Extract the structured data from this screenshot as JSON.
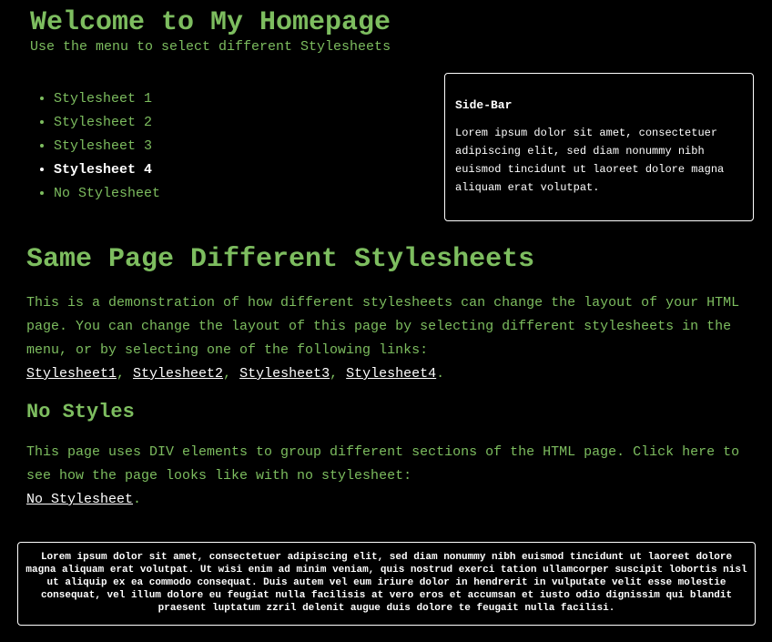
{
  "header": {
    "title": "Welcome to My Homepage",
    "subtitle": "Use the menu to select different Stylesheets"
  },
  "menu": {
    "items": [
      {
        "label": "Stylesheet 1",
        "active": false
      },
      {
        "label": "Stylesheet 2",
        "active": false
      },
      {
        "label": "Stylesheet 3",
        "active": false
      },
      {
        "label": "Stylesheet 4",
        "active": true
      },
      {
        "label": "No Stylesheet",
        "active": false
      }
    ]
  },
  "sidebar": {
    "title": "Side-Bar",
    "text": "Lorem ipsum dolor sit amet, consectetuer adipiscing elit, sed diam nonummy nibh euismod tincidunt ut laoreet dolore magna aliquam erat volutpat."
  },
  "main": {
    "heading": "Same Page Different Stylesheets",
    "intro": "This is a demonstration of how different stylesheets can change the layout of your HTML page. You can change the layout of this page by selecting different stylesheets in the menu, or by selecting one of the following links:",
    "links": [
      "Stylesheet1",
      "Stylesheet2",
      "Stylesheet3",
      "Stylesheet4"
    ],
    "sep": ", ",
    "period": ".",
    "section2_heading": "No Styles",
    "section2_text": "This page uses DIV elements to group different sections of the HTML page. Click here to see how the page looks like with no stylesheet:",
    "no_style_link": "No Stylesheet"
  },
  "footer": {
    "text": "Lorem ipsum dolor sit amet, consectetuer adipiscing elit, sed diam nonummy nibh euismod tincidunt ut laoreet dolore magna aliquam erat volutpat. Ut wisi enim ad minim veniam, quis nostrud exerci tation ullamcorper suscipit lobortis nisl ut aliquip ex ea commodo consequat. Duis autem vel eum iriure dolor in hendrerit in vulputate velit esse molestie consequat, vel illum dolore eu feugiat nulla facilisis at vero eros et accumsan et iusto odio dignissim qui blandit praesent luptatum zzril delenit augue duis dolore te feugait nulla facilisi."
  },
  "colors": {
    "background": "#000000",
    "accent_green": "#7dbd5f",
    "white": "#ffffff"
  }
}
